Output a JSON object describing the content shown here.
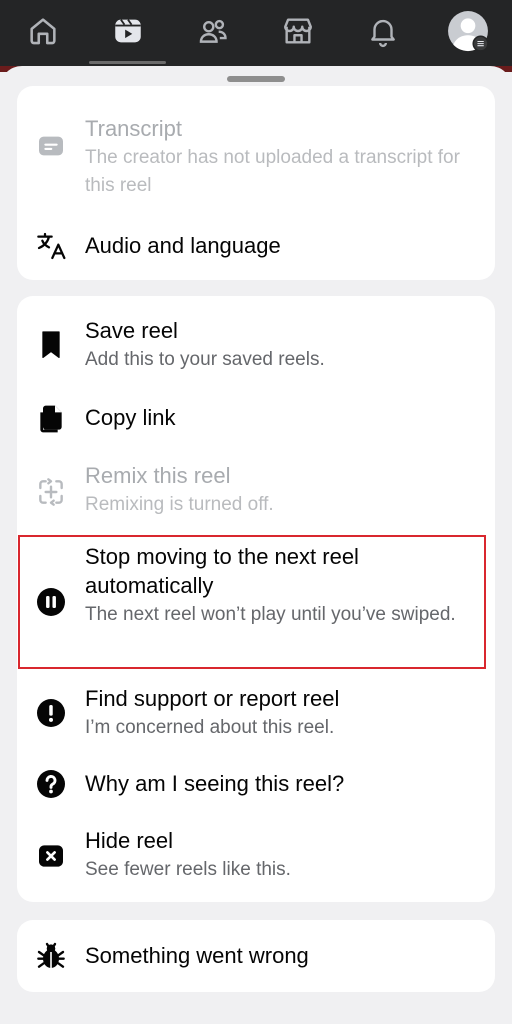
{
  "nav": {
    "items": [
      {
        "icon": "home-icon"
      },
      {
        "icon": "reels-icon",
        "active": true
      },
      {
        "icon": "friends-icon"
      },
      {
        "icon": "marketplace-icon"
      },
      {
        "icon": "bell-icon"
      },
      {
        "icon": "profile-avatar-icon"
      }
    ]
  },
  "sheet": {
    "group1": {
      "transcript": {
        "title": "Transcript",
        "sub": "The creator has not uploaded a transcript for this reel",
        "disabled": true
      },
      "audio": {
        "title": "Audio and language"
      }
    },
    "group2": {
      "save": {
        "title": "Save reel",
        "sub": "Add this to your saved reels."
      },
      "copy": {
        "title": "Copy link"
      },
      "remix": {
        "title": "Remix this reel",
        "sub": "Remixing is turned off.",
        "disabled": true
      },
      "stop": {
        "title": "Stop moving to the next reel automatically",
        "sub": "The next reel won’t play until you’ve swiped."
      },
      "support": {
        "title": "Find support or report reel",
        "sub": "I’m concerned about this reel."
      },
      "why": {
        "title": "Why am I seeing this reel?"
      },
      "hide": {
        "title": "Hide reel",
        "sub": "See fewer reels like this."
      }
    },
    "group3": {
      "wrong": {
        "title": "Something went wrong"
      }
    }
  },
  "colors": {
    "highlight": "#d9272e",
    "nav_bg": "#242526",
    "sheet_bg": "#f0f0f2"
  }
}
